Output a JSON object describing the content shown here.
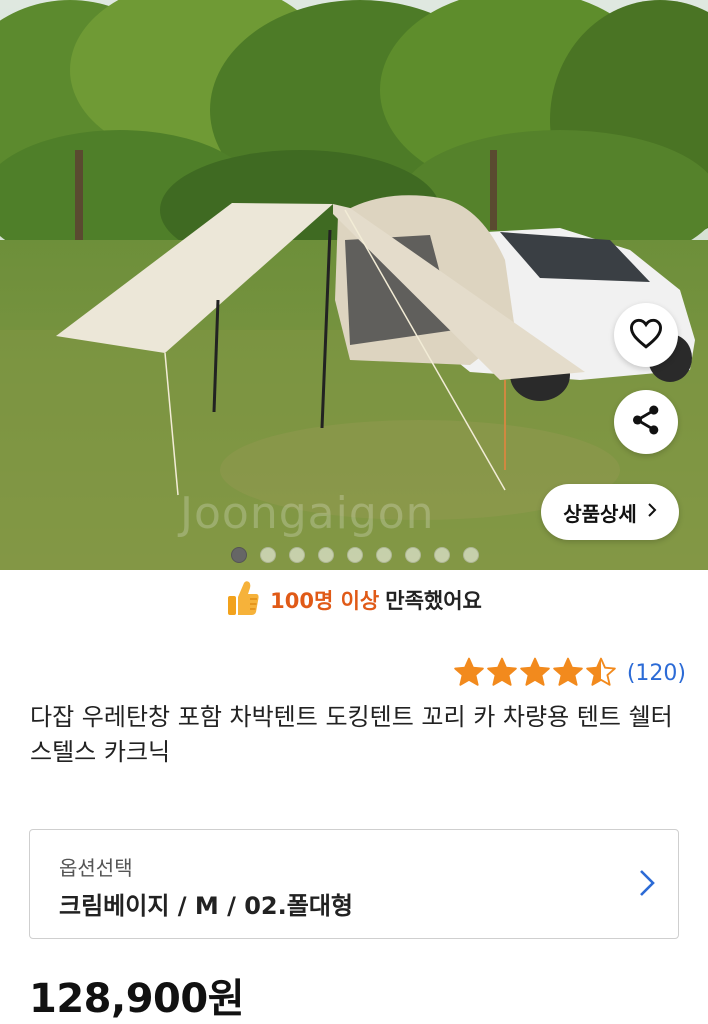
{
  "hero": {
    "watermark": "Joongaigon",
    "detail_button_label": "상품상세",
    "carousel": {
      "total": 9,
      "active_index": 0
    }
  },
  "icons": {
    "wishlist": "heart-outline-icon",
    "share": "share-icon",
    "detail_chevron": "chevron-right-icon",
    "satisfaction": "thumbs-up-icon",
    "option_chevron": "chevron-right-icon"
  },
  "satisfaction": {
    "highlight": "100명 이상",
    "text": "만족했어요"
  },
  "rating": {
    "score": 4.5,
    "max": 5,
    "count_label": "(120)"
  },
  "product": {
    "title": "다잡 우레탄창 포함 차박텐트 도킹텐트 꼬리 카 차량용 텐트 쉘터 스텔스 카크닉"
  },
  "option": {
    "label": "옵션선택",
    "value": "크림베이지 / M / 02.폴대형"
  },
  "price": {
    "label": "128,900원"
  },
  "colors": {
    "star": "#f28a1d",
    "accent_orange": "#e05a17",
    "link_blue": "#2c6bd6",
    "chevron_blue": "#2c6bd6"
  }
}
